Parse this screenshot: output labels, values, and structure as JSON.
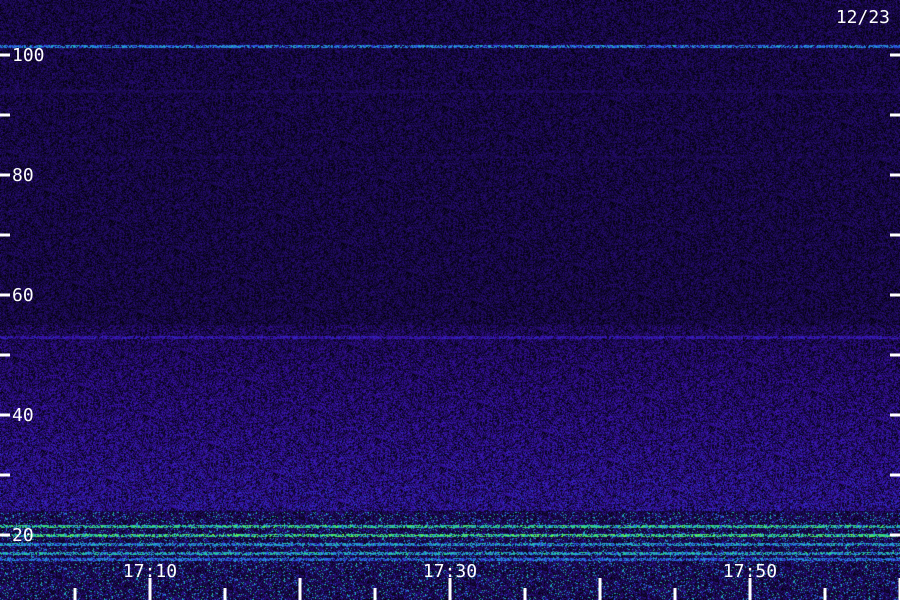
{
  "date_label": "12/23",
  "chart_data": {
    "type": "heatmap",
    "title": "",
    "xlabel": "",
    "ylabel": "",
    "x_tick_labels": [
      "17:10",
      "17:30",
      "17:50"
    ],
    "y_tick_labels": [
      "100",
      "80",
      "60",
      "40",
      "20"
    ],
    "y_ticks": [
      100,
      80,
      60,
      40,
      20
    ],
    "y_minor_ticks": [
      90,
      70,
      50,
      30
    ],
    "ylim": [
      15,
      105
    ],
    "xlim": [
      "17:05",
      "18:05"
    ],
    "colormap": [
      "#000000",
      "#1a0a50",
      "#3a10a8",
      "#2a3ad8",
      "#20a0e0",
      "#30e070",
      "#80ff40"
    ],
    "background_color": "#200a50",
    "tick_color": "#ffffff",
    "bands": [
      {
        "y": 101.5,
        "intensity": 0.75
      },
      {
        "y": 94,
        "intensity": 0.2
      },
      {
        "y": 83,
        "intensity": 0.15
      },
      {
        "y": 53,
        "intensity": 0.45
      },
      {
        "y": 21.5,
        "intensity": 0.95
      },
      {
        "y": 20,
        "intensity": 1.0
      },
      {
        "y": 18.5,
        "intensity": 0.8
      },
      {
        "y": 17,
        "intensity": 0.85
      },
      {
        "y": 16,
        "intensity": 0.7
      }
    ]
  }
}
